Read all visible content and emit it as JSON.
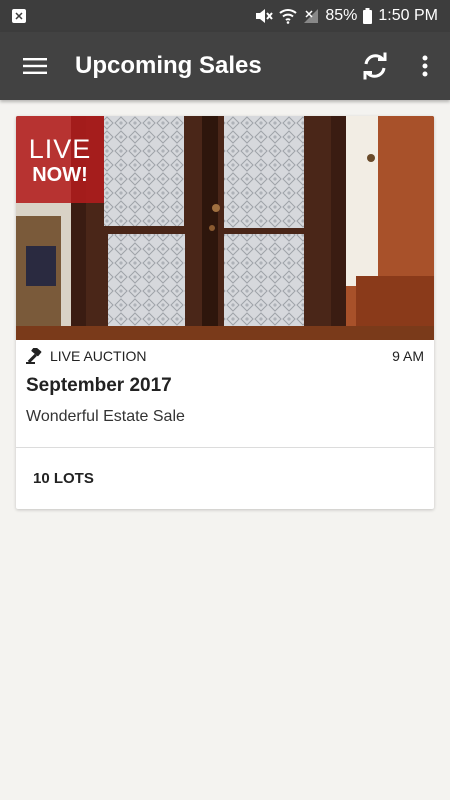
{
  "status_bar": {
    "battery": "85%",
    "time": "1:50 PM"
  },
  "app_bar": {
    "title": "Upcoming Sales"
  },
  "sales": [
    {
      "badge_live": "LIVE",
      "badge_now": "NOW!",
      "type": "LIVE AUCTION",
      "time": "9 AM",
      "title": "September 2017",
      "description": "Wonderful Estate Sale",
      "lots": "10 LOTS"
    }
  ],
  "colors": {
    "app_bar": "#424242",
    "status_bar": "#3d3d3d",
    "live_badge": "#b21c1c",
    "background": "#f4f3f0"
  }
}
